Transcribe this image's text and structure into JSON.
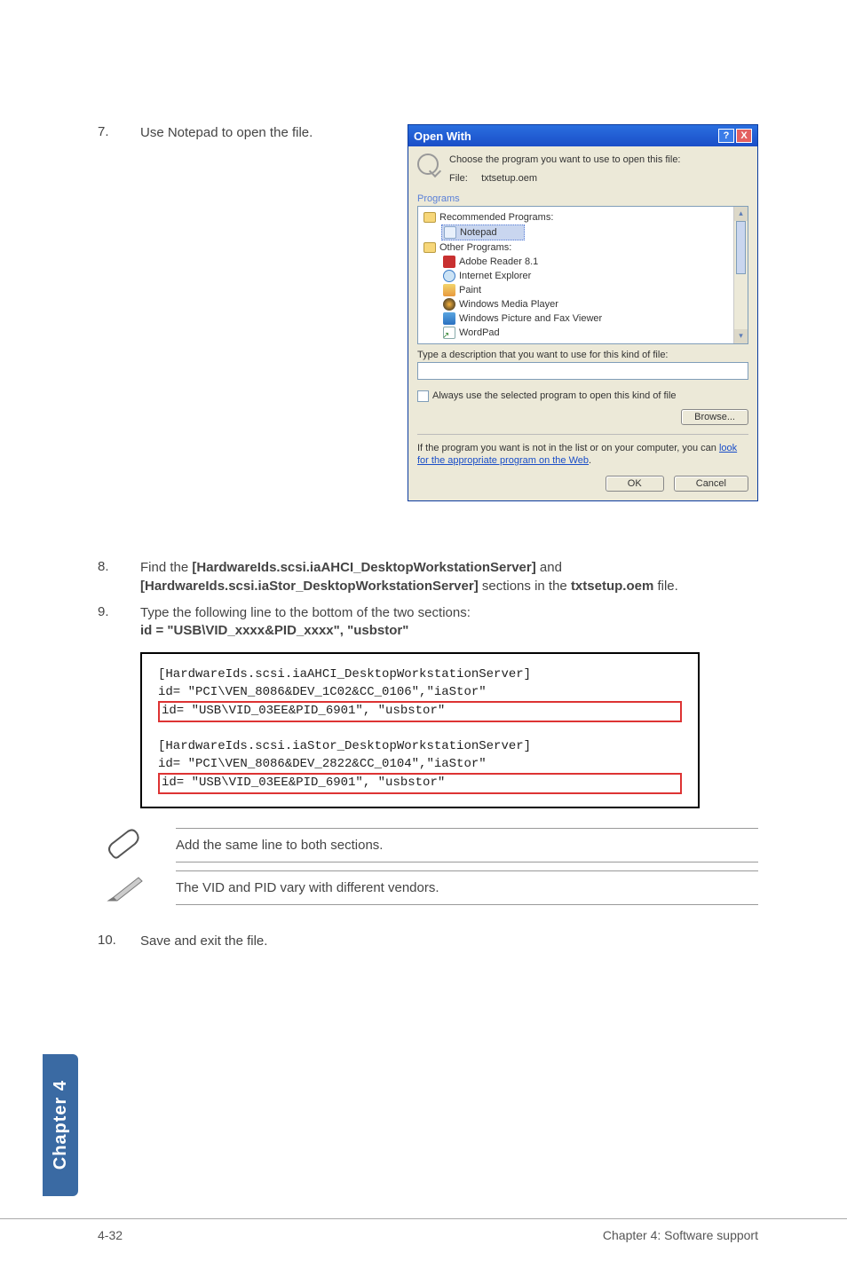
{
  "steps": {
    "7": {
      "num": "7.",
      "text": "Use Notepad to open the file."
    },
    "8": {
      "num": "8.",
      "lead": "Find the ",
      "b1": "[HardwareIds.scsi.iaAHCI_DesktopWorkstationServer]",
      "mid1": " and ",
      "b2": "[HardwareIds.scsi.iaStor_DesktopWorkstationServer]",
      "mid2": " sections in the ",
      "b3": "txtsetup.oem",
      "tail": " file."
    },
    "9": {
      "num": "9.",
      "line1": "Type the following line to the bottom of the two sections:",
      "line2": "id = \"USB\\VID_xxxx&PID_xxxx\", \"usbstor\""
    },
    "10": {
      "num": "10.",
      "text": "Save and exit the file."
    }
  },
  "dialog": {
    "title": "Open With",
    "help": "?",
    "close": "X",
    "choose": "Choose the program you want to use to open this file:",
    "file_label": "File:",
    "file_name": "txtsetup.oem",
    "programs_label": "Programs",
    "rec_label": "Recommended Programs:",
    "notepad": "Notepad",
    "other_label": "Other Programs:",
    "items": {
      "adobe": "Adobe Reader 8.1",
      "ie": "Internet Explorer",
      "paint": "Paint",
      "wmp": "Windows Media Player",
      "fax": "Windows Picture and Fax Viewer",
      "wordpad": "WordPad"
    },
    "desc_label": "Type a description that you want to use for this kind of file:",
    "always": "Always use the selected program to open this kind of file",
    "browse": "Browse...",
    "web_msg_1": "If the program you want is not in the list or on your computer, you can ",
    "web_link": "look for the appropriate program on the Web",
    "web_msg_2": ".",
    "ok": "OK",
    "cancel": "Cancel"
  },
  "code": {
    "l1": "[HardwareIds.scsi.iaAHCI_DesktopWorkstationServer]",
    "l2": "id= \"PCI\\VEN_8086&DEV_1C02&CC_0106\",\"iaStor\"",
    "l3": "id= \"USB\\VID_03EE&PID_6901\", \"usbstor\"",
    "l4": "[HardwareIds.scsi.iaStor_DesktopWorkstationServer]",
    "l5": "id= \"PCI\\VEN_8086&DEV_2822&CC_0104\",\"iaStor\"",
    "l6": "id= \"USB\\VID_03EE&PID_6901\", \"usbstor\""
  },
  "notes": {
    "n1": "Add the same line to both sections.",
    "n2": "The VID and PID vary with different vendors."
  },
  "sidebar": "Chapter 4",
  "footer": {
    "left": "4-32",
    "right": "Chapter 4: Software support"
  }
}
